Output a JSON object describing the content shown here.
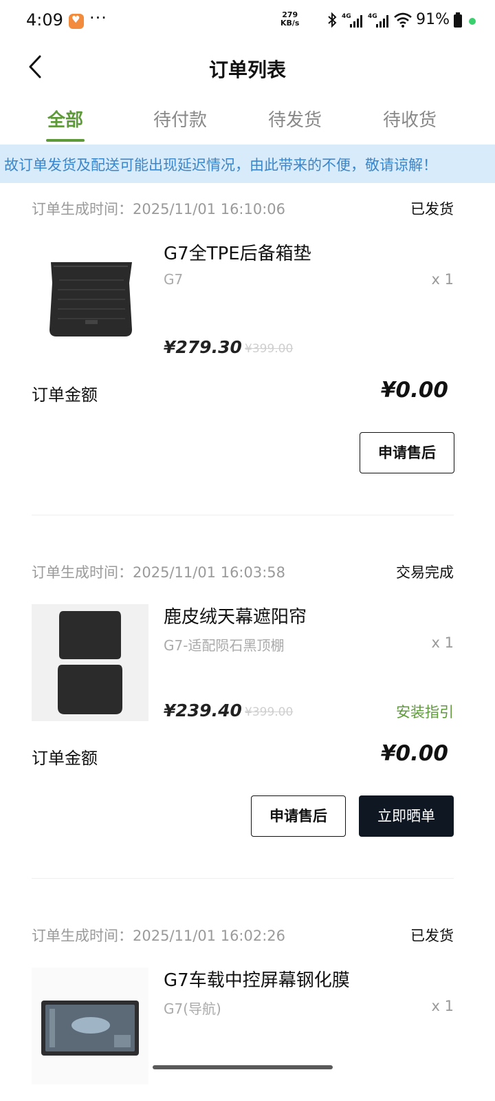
{
  "status_bar": {
    "time": "4:09",
    "speed_value": "279",
    "speed_unit": "KB/s",
    "battery": "91%"
  },
  "nav": {
    "title": "订单列表"
  },
  "tabs": [
    {
      "label": "全部",
      "active": true
    },
    {
      "label": "待付款",
      "active": false
    },
    {
      "label": "待发货",
      "active": false
    },
    {
      "label": "待收货",
      "active": false
    }
  ],
  "notice": {
    "text": "故订单发货及配送可能出现延迟情况，由此带来的不便，敬请谅解！"
  },
  "orders": [
    {
      "time_label": "订单生成时间：",
      "time": "2025/11/01 16:10:06",
      "status": "已发货",
      "product_name": "G7全TPE后备箱垫",
      "spec": "G7",
      "qty": "x 1",
      "price": "¥279.30",
      "original_price": "¥399.00",
      "amount_label": "订单金额",
      "amount": "¥0.00",
      "buttons": [
        "申请售后"
      ]
    },
    {
      "time_label": "订单生成时间：",
      "time": "2025/11/01 16:03:58",
      "status": "交易完成",
      "product_name": "鹿皮绒天幕遮阳帘",
      "spec": "G7-适配陨石黑顶棚",
      "qty": "x 1",
      "price": "¥239.40",
      "original_price": "¥399.00",
      "link": "安装指引",
      "amount_label": "订单金额",
      "amount": "¥0.00",
      "buttons": [
        "申请售后",
        "立即晒单"
      ]
    },
    {
      "time_label": "订单生成时间：",
      "time": "2025/11/01 16:02:26",
      "status": "已发货",
      "product_name": "G7车载中控屏幕钢化膜",
      "spec": "G7(导航)",
      "qty": "x 1"
    }
  ],
  "colors": {
    "accent_green": "#5f9a3a",
    "notice_bg": "#d8ebfb",
    "notice_text": "#3a86cb",
    "dark_button": "#0f1722"
  }
}
